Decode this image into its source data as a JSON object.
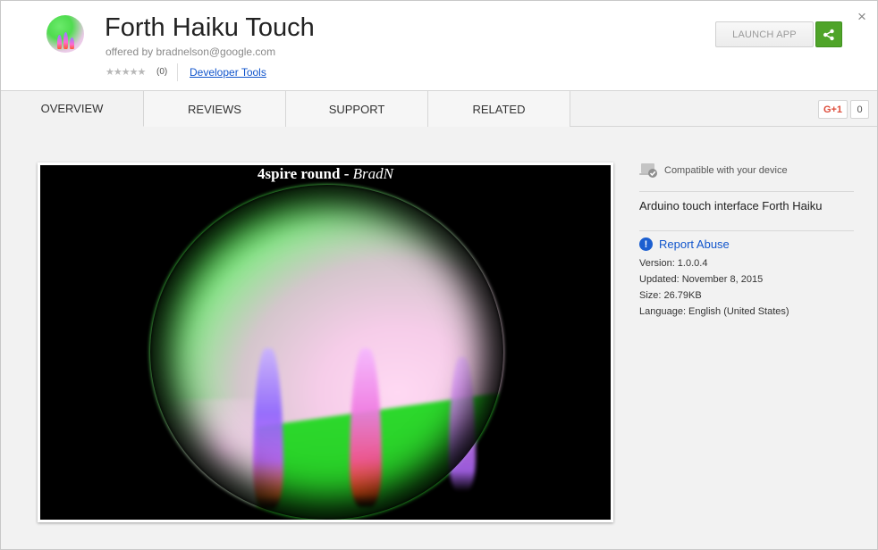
{
  "app": {
    "title": "Forth Haiku Touch",
    "offered_by": "offered by bradnelson@google.com",
    "stars": "★★★★★",
    "rating_count": "(0)",
    "category": "Developer Tools",
    "launch_label": "LAUNCH APP",
    "close_glyph": "×"
  },
  "tabs": [
    {
      "label": "OVERVIEW",
      "active": true
    },
    {
      "label": "REVIEWS",
      "active": false
    },
    {
      "label": "SUPPORT",
      "active": false
    },
    {
      "label": "RELATED",
      "active": false
    }
  ],
  "gplus": {
    "label": "G+1",
    "count": "0"
  },
  "screenshot": {
    "caption_main": "4spire round - ",
    "caption_author": "BradN"
  },
  "details": {
    "compatible": "Compatible with your device",
    "description": "Arduino touch interface Forth Haiku",
    "report_abuse": "Report Abuse",
    "version": "Version: 1.0.0.4",
    "updated": "Updated: November 8, 2015",
    "size": "Size: 26.79KB",
    "language": "Language: English (United States)"
  },
  "colors": {
    "share_green": "#4fa429",
    "link_blue": "#1155cc",
    "gplus_red": "#dd4b39"
  },
  "icons": [
    "app-icon",
    "share-icon",
    "close-icon",
    "device-check-icon",
    "report-abuse-icon",
    "star-icon"
  ]
}
